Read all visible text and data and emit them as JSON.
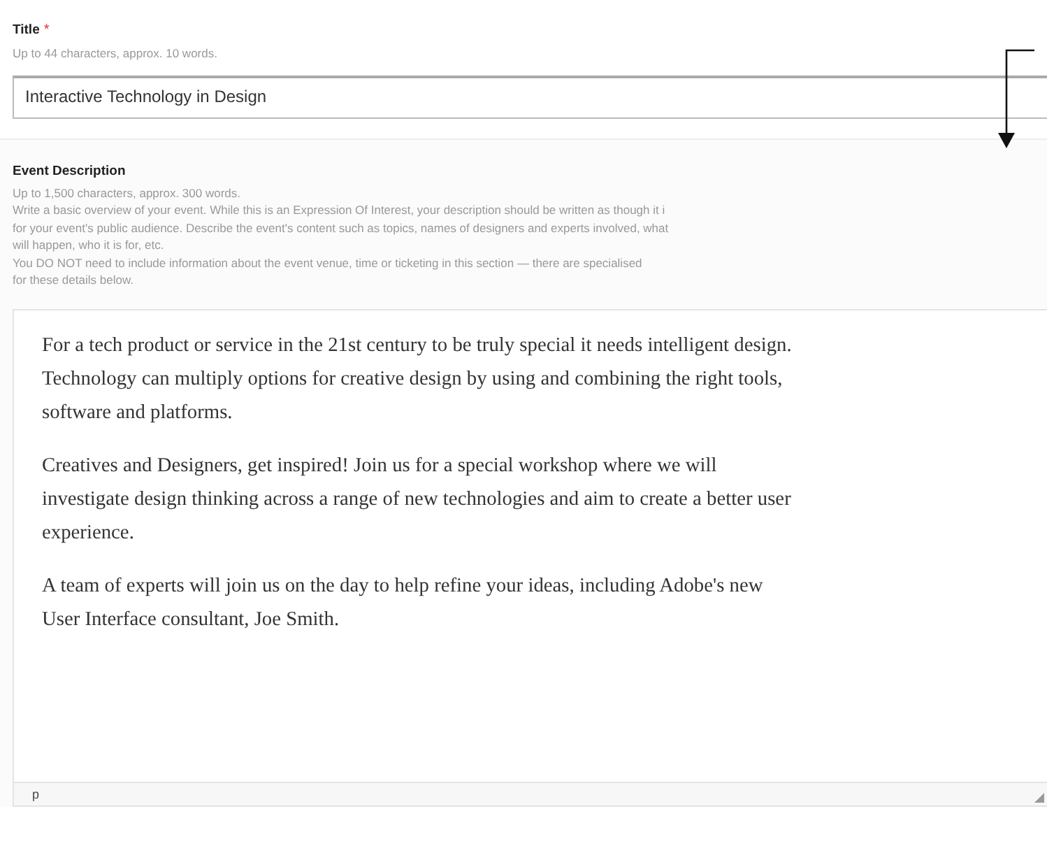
{
  "title_field": {
    "label": "Title",
    "required_mark": "*",
    "hint": "Up to 44 characters, approx. 10 words.",
    "value": "Interactive Technology in Design"
  },
  "description_field": {
    "label": "Event Description",
    "hints": [
      "Up to 1,500 characters, approx. 300 words.",
      "Write a basic overview of your event. While this is an Expression Of Interest, your description should be written as though it i",
      "for your event's public audience. Describe the event's content such as topics, names of designers and experts involved, what",
      "will happen, who it is for, etc.",
      "You DO NOT need to include information about the event venue, time or ticketing in this section — there are specialised",
      "for these details below."
    ],
    "paragraphs": [
      [
        "For a tech product or service in the 21st century to be truly special it needs intelligent design.",
        "Technology can multiply options for creative design by using and combining the right tools,",
        "software and platforms."
      ],
      [
        "Creatives and Designers, get inspired! Join us for a special workshop where we will",
        "investigate design thinking across a range of new technologies and aim to create a better user",
        "experience."
      ],
      [
        "A team of experts will join us on the day to help refine your ideas, including Adobe's new",
        "User Interface consultant, Joe Smith."
      ]
    ],
    "status_path": "p"
  }
}
